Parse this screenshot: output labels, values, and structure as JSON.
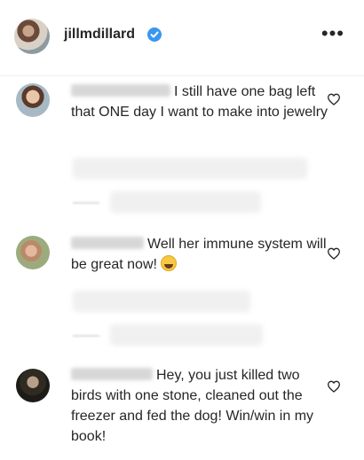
{
  "header": {
    "username": "jillmdillard",
    "more_icon": "more-horizontal-icon",
    "verified_icon": "verified-badge-icon"
  },
  "comments": [
    {
      "text_line1": "I still have one bag",
      "text_rest": "left that ONE day I want to make into jewelry",
      "like_icon": "heart-outline-icon"
    },
    {
      "text_line1": "Well her immune",
      "text_rest": "system will be great now!",
      "emoji_icon": "laughing-emoji-icon",
      "like_icon": "heart-outline-icon"
    },
    {
      "text_line1": "Hey, you just killed",
      "text_rest": "two birds with one stone, cleaned out the freezer and fed the dog! Win/win in my book!",
      "like_icon": "heart-outline-icon"
    }
  ],
  "colors": {
    "text": "#262626",
    "verified": "#3897f0",
    "divider": "#efefef"
  }
}
